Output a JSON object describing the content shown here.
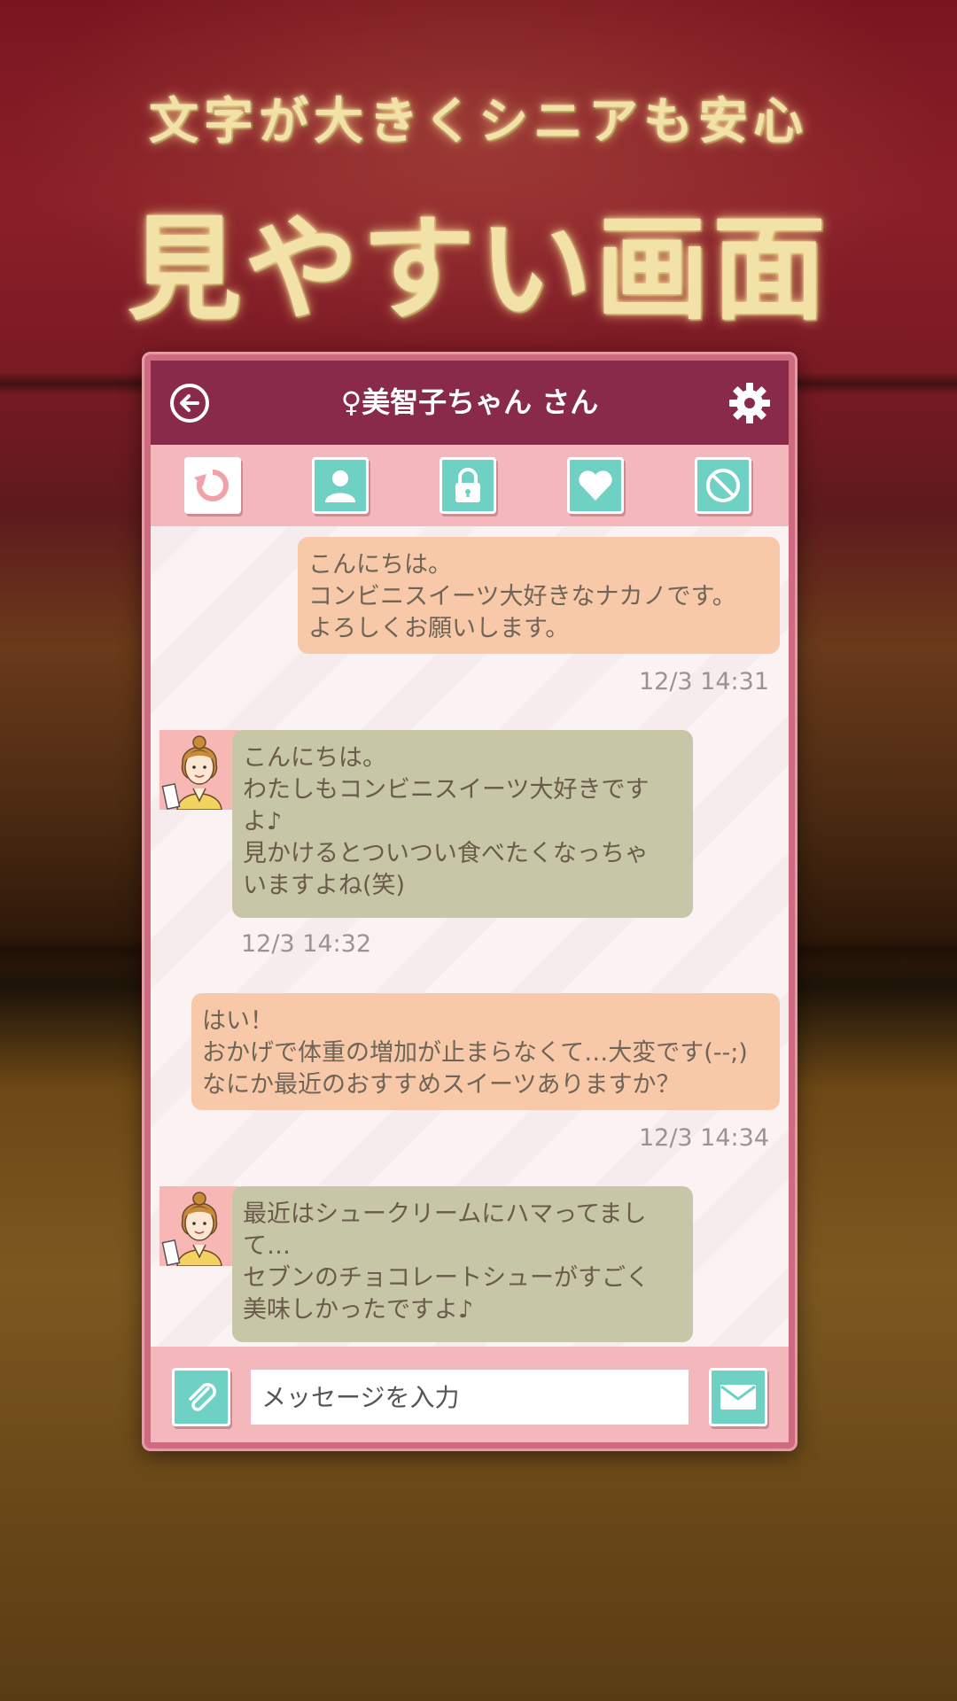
{
  "promo": {
    "subtitle": "文字が大きくシニアも安心",
    "title": "見やすい画面"
  },
  "header": {
    "back_icon": "back-arrow-icon",
    "title": "♀美智子ちゃん さん",
    "settings_icon": "gear-icon"
  },
  "toolbar": {
    "items": [
      {
        "icon": "refresh-icon"
      },
      {
        "icon": "profile-icon"
      },
      {
        "icon": "lock-icon"
      },
      {
        "icon": "heart-icon"
      },
      {
        "icon": "block-icon"
      }
    ]
  },
  "messages": [
    {
      "from": "me",
      "text": "こんにちは。\nコンビニスイーツ大好きなナカノです。\nよろしくお願いします。",
      "time": "12/3 14:31"
    },
    {
      "from": "them",
      "text": "こんにちは。\nわたしもコンビニスイーツ大好きです\nよ♪\n見かけるとついつい食べたくなっちゃ\nいますよね(笑)",
      "time": "12/3 14:32"
    },
    {
      "from": "me",
      "text": "はい！\nおかげで体重の増加が止まらなくて…大変です(--;)\nなにか最近のおすすめスイーツありますか？",
      "time": "12/3 14:34"
    },
    {
      "from": "them",
      "text": "最近はシュークリームにハマってまし\nて…\nセブンのチョコレートシューがすごく\n美味しかったですよ♪"
    }
  ],
  "input": {
    "placeholder": "メッセージを入力",
    "attach_icon": "paperclip-icon",
    "send_icon": "envelope-icon"
  },
  "colors": {
    "header_bg": "#8a2a4a",
    "toolbar_bg": "#f4b8bc",
    "frame": "#cf6b80",
    "my_bubble": "#f8c9a8",
    "their_bubble": "#c7c6a6",
    "button_teal": "#6fd1c3"
  }
}
